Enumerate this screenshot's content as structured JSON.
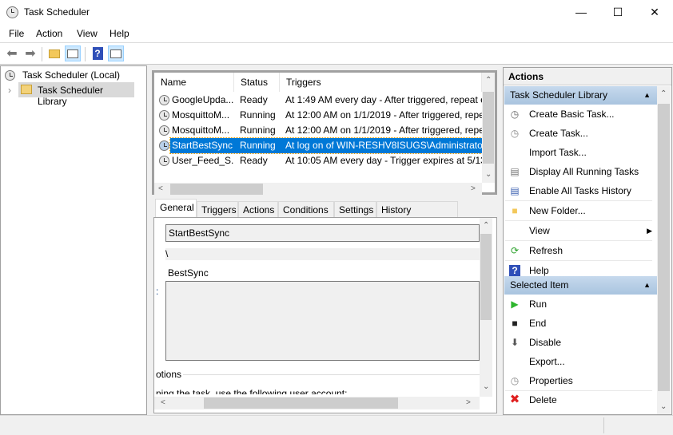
{
  "window": {
    "title": "Task Scheduler",
    "icon": "clock-icon",
    "controls": [
      "minimize",
      "maximize",
      "close"
    ]
  },
  "menu": [
    "File",
    "Action",
    "View",
    "Help"
  ],
  "toolbar": [
    "back-icon",
    "forward-icon",
    "up-folder-icon",
    "show-hide-console-tree-icon",
    "help-icon",
    "show-hide-action-pane-icon"
  ],
  "tree": {
    "root": "Task Scheduler (Local)",
    "child": "Task Scheduler Library"
  },
  "tasks": {
    "columns": [
      "Name",
      "Status",
      "Triggers"
    ],
    "rows": [
      {
        "name": "GoogleUpda...",
        "status": "Ready",
        "trigger": "At 1:49 AM every day - After triggered, repeat e"
      },
      {
        "name": "MosquittoM...",
        "status": "Running",
        "trigger": "At 12:00 AM on 1/1/2019 - After triggered, repe"
      },
      {
        "name": "MosquittoM...",
        "status": "Running",
        "trigger": "At 12:00 AM on 1/1/2019 - After triggered, repe"
      },
      {
        "name": "StartBestSync",
        "status": "Running",
        "trigger": "At log on of WIN-RESHV8ISUGS\\Administrator",
        "selected": true
      },
      {
        "name": "User_Feed_S...",
        "status": "Ready",
        "trigger": "At 10:05 AM every day - Trigger expires at 5/13/"
      }
    ]
  },
  "detail": {
    "tabs": [
      "General",
      "Triggers",
      "Actions",
      "Conditions",
      "Settings",
      "History (disabled)"
    ],
    "active_tab": "General",
    "name_value": "StartBestSync",
    "location_value": "\\",
    "author_value": "BestSync",
    "desc_label_fragment": ":",
    "options_label": "otions",
    "account_text": "ning the task, use the following user account:"
  },
  "actions": {
    "header": "Actions",
    "groups": [
      {
        "title": "Task Scheduler Library",
        "items": [
          {
            "label": "Create Basic Task...",
            "icon": "create-basic-task-icon"
          },
          {
            "label": "Create Task...",
            "icon": "create-task-icon"
          },
          {
            "label": "Import Task...",
            "icon": ""
          },
          {
            "label": "Display All Running Tasks",
            "icon": "running-tasks-icon"
          },
          {
            "label": "Enable All Tasks History",
            "icon": "history-icon"
          },
          {
            "label": "New Folder...",
            "icon": "folder-icon"
          },
          {
            "label": "View",
            "icon": "",
            "submenu": true
          },
          {
            "label": "Refresh",
            "icon": "refresh-icon"
          },
          {
            "label": "Help",
            "icon": "help-icon"
          }
        ]
      },
      {
        "title": "Selected Item",
        "items": [
          {
            "label": "Run",
            "icon": "run-icon"
          },
          {
            "label": "End",
            "icon": "stop-icon"
          },
          {
            "label": "Disable",
            "icon": "disable-icon"
          },
          {
            "label": "Export...",
            "icon": ""
          },
          {
            "label": "Properties",
            "icon": "properties-icon"
          },
          {
            "label": "Delete",
            "icon": "delete-icon"
          }
        ]
      }
    ]
  },
  "colors": {
    "selection": "#0078d7",
    "group_header": "#b5cde6"
  }
}
